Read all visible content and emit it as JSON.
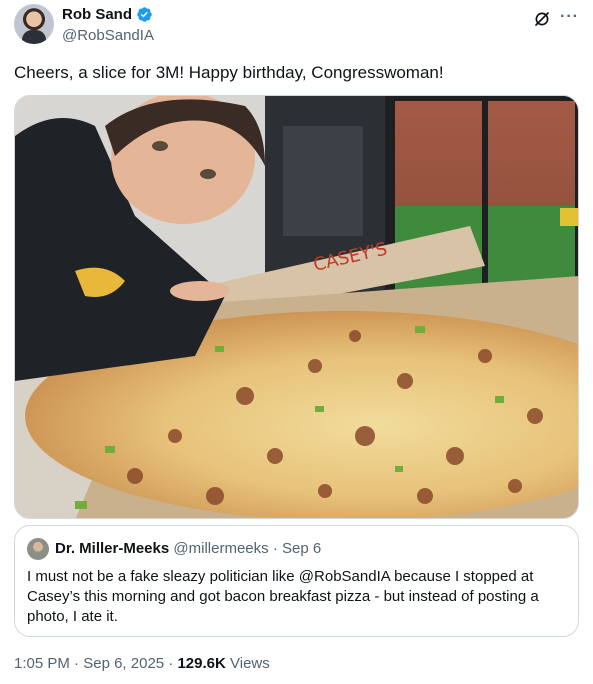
{
  "author": {
    "display_name": "Rob Sand",
    "handle": "@RobSandIA",
    "avatar_icon": "profile-avatar",
    "verified_icon": "verified-badge-icon",
    "verified_color": "#1d9bf0"
  },
  "tweet": {
    "text": "Cheers, a slice for 3M! Happy birthday, Congresswoman!",
    "media_icon": "photo-pizza-selfie"
  },
  "quote": {
    "display_name": "Dr. Miller-Meeks",
    "handle": "@millermeeks",
    "separator": "·",
    "date": "Sep 6",
    "text": "I must not be a fake sleazy politician like @RobSandIA because I stopped at Casey’s this morning and got bacon breakfast pizza  - but instead of posting a photo, I ate it."
  },
  "meta": {
    "time": "1:05 PM",
    "sep1": " · ",
    "date": "Sep 6, 2025",
    "sep2": " · ",
    "views_count": "129.6K",
    "views_label": " Views"
  },
  "icons": {
    "grok": "grok-icon",
    "more": "more-icon"
  }
}
